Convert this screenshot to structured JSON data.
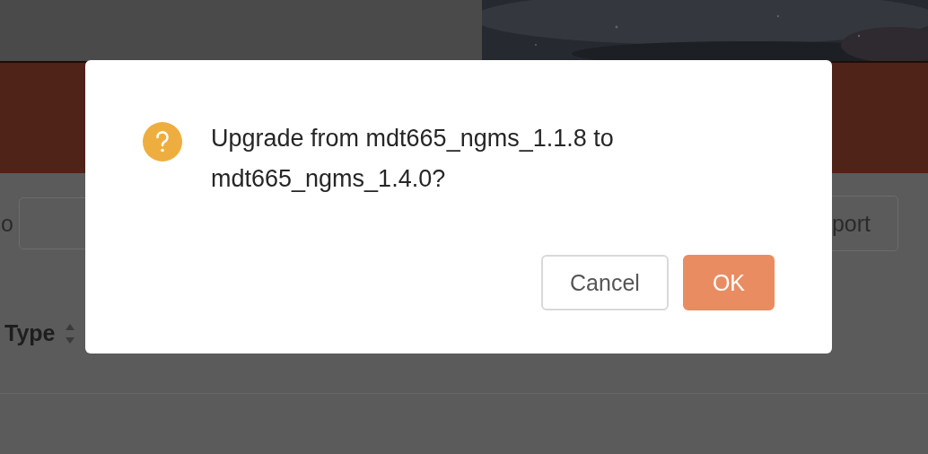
{
  "toolbar": {
    "label": "o",
    "button": "port"
  },
  "table": {
    "columns": [
      {
        "label": "Type"
      }
    ]
  },
  "dialog": {
    "message": "Upgrade from mdt665_ngms_1.1.8 to mdt665_ngms_1.4.0?",
    "buttons": [
      {
        "label": "Cancel",
        "kind": "default"
      },
      {
        "label": "OK",
        "kind": "primary"
      }
    ]
  }
}
